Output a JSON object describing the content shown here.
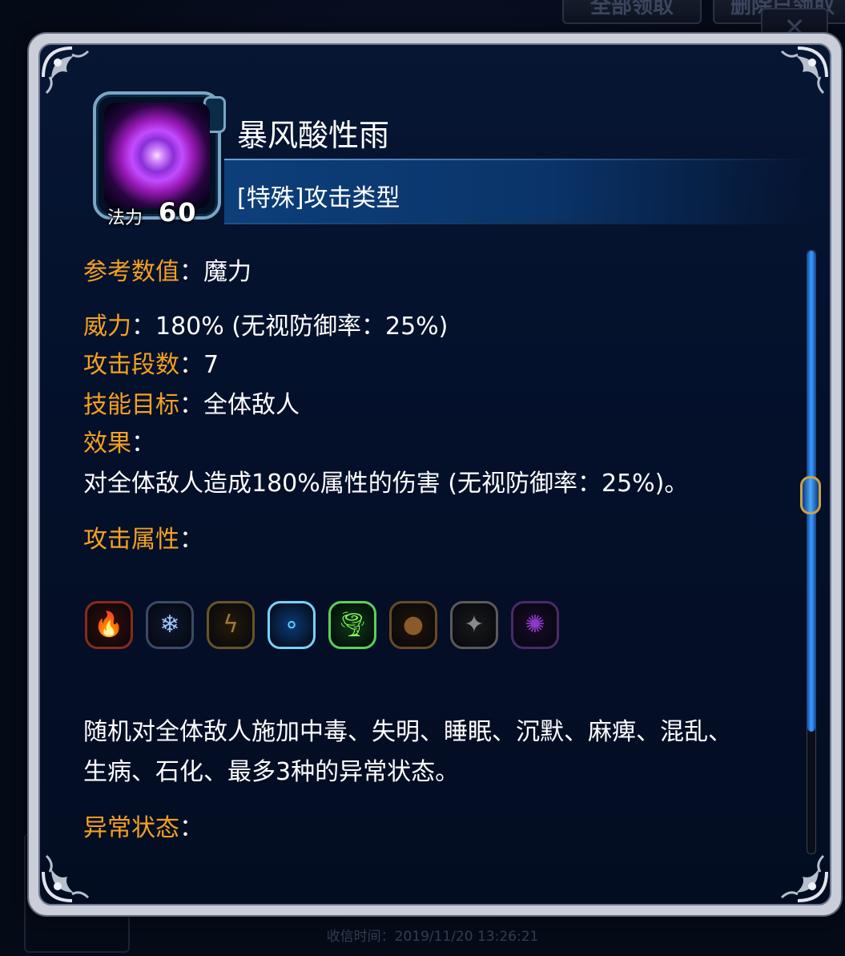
{
  "background": {
    "buttons": [
      "全部领取",
      "删除已领取"
    ],
    "close_glyph": "✕",
    "receive_time": "收信时间：2019/11/20 13:26:21"
  },
  "skill": {
    "name": "暴风酸性雨",
    "type": "[特殊]攻击类型",
    "mana_label": "法力",
    "mana_value": "60",
    "icon": "purple-vortex-icon"
  },
  "details": {
    "ref_label": "参考数值",
    "ref_value": "：魔力",
    "power_label": "威力",
    "power_value": "：180% (无视防御率：25%)",
    "hits_label": "攻击段数",
    "hits_value": "：7",
    "target_label": "技能目标",
    "target_value": "：全体敌人",
    "effect_label": "效果",
    "effect_colon": "：",
    "effect_text": "对全体敌人造成180%属性的伤害 (无视防御率：25%)。",
    "attr_label": "攻击属性",
    "attr_colon": "：",
    "status_text_line1": "随机对全体敌人施加中毒、失明、睡眠、沉默、麻痺、混乱、",
    "status_text_line2": "生病、石化、最多3种的异常状态。",
    "status_label": "异常状态",
    "status_colon": "："
  },
  "attributes": [
    {
      "name": "fire-attribute-icon",
      "glyph": "🔥",
      "border": "#8a2a1a",
      "bg": "#3a0d08",
      "color": "#ff7a2a"
    },
    {
      "name": "ice-attribute-icon",
      "glyph": "❄",
      "border": "#3c4a66",
      "bg": "#0e1830",
      "color": "#9fc6ff"
    },
    {
      "name": "thunder-attribute-icon",
      "glyph": "ϟ",
      "border": "#6a5424",
      "bg": "#241a08",
      "color": "#9c7a3a"
    },
    {
      "name": "water-attribute-icon",
      "glyph": "∘",
      "border": "#7ad0ff",
      "bg": "#0a3a78",
      "color": "#5fd4ff"
    },
    {
      "name": "wind-attribute-icon",
      "glyph": "🌪",
      "border": "#5ad05a",
      "bg": "#0c3a14",
      "color": "#8aff5a"
    },
    {
      "name": "earth-attribute-icon",
      "glyph": "●",
      "border": "#6a4a24",
      "bg": "#241408",
      "color": "#8a5a2a"
    },
    {
      "name": "light-attribute-icon",
      "glyph": "✦",
      "border": "#5a5a5a",
      "bg": "#1a1a1a",
      "color": "#8a8a8a"
    },
    {
      "name": "dark-attribute-icon",
      "glyph": "✺",
      "border": "#4a2a6a",
      "bg": "#1a0a2a",
      "color": "#8a3ac8"
    }
  ],
  "scrollbar": {
    "position_fraction": 0.4
  }
}
